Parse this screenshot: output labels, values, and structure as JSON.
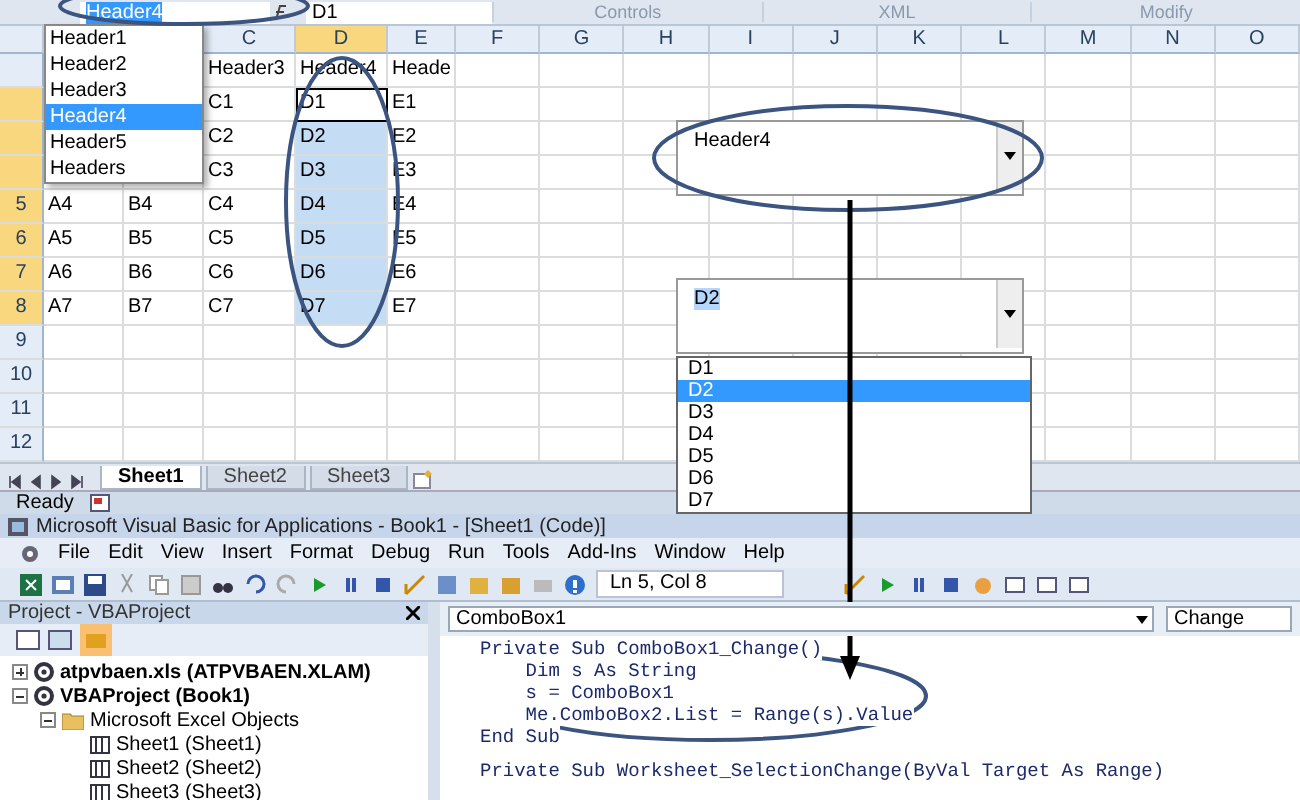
{
  "excel": {
    "name_box": "Header4",
    "formula": "D1",
    "ribbon_groups": [
      "Controls",
      "XML",
      "Modify"
    ],
    "name_box_list": [
      {
        "label": "Header1",
        "selected": false
      },
      {
        "label": "Header2",
        "selected": false
      },
      {
        "label": "Header3",
        "selected": false
      },
      {
        "label": "Header4",
        "selected": true
      },
      {
        "label": "Header5",
        "selected": false
      },
      {
        "label": "Headers",
        "selected": false
      }
    ],
    "columns": [
      {
        "label": "C",
        "selected": false
      },
      {
        "label": "D",
        "selected": true
      },
      {
        "label": "E",
        "selected": false
      },
      {
        "label": "F",
        "selected": false
      },
      {
        "label": "G",
        "selected": false
      },
      {
        "label": "H",
        "selected": false
      },
      {
        "label": "I",
        "selected": false
      },
      {
        "label": "J",
        "selected": false
      },
      {
        "label": "K",
        "selected": false
      },
      {
        "label": "L",
        "selected": false
      },
      {
        "label": "M",
        "selected": false
      },
      {
        "label": "N",
        "selected": false
      },
      {
        "label": "O",
        "selected": false
      }
    ],
    "rows": [
      {
        "cells": [
          "Header3",
          "Header4",
          "Heade"
        ],
        "selected": false
      },
      {
        "cells": [
          "C1",
          "D1",
          "E1"
        ],
        "selected": true,
        "active": true
      },
      {
        "cells": [
          "C2",
          "D2",
          "E2"
        ],
        "selected": true
      },
      {
        "cells": [
          "C3",
          "D3",
          "E3"
        ],
        "selected": true
      },
      {
        "number": "5",
        "a": "A4",
        "b": "B4",
        "cells": [
          "C4",
          "D4",
          "E4"
        ],
        "selected": true
      },
      {
        "number": "6",
        "a": "A5",
        "b": "B5",
        "cells": [
          "C5",
          "D5",
          "E5"
        ],
        "selected": true
      },
      {
        "number": "7",
        "a": "A6",
        "b": "B6",
        "cells": [
          "C6",
          "D6",
          "E6"
        ],
        "selected": true
      },
      {
        "number": "8",
        "a": "A7",
        "b": "B7",
        "cells": [
          "C7",
          "D7",
          "E7"
        ],
        "selected": true
      },
      {
        "number": "9",
        "selected": false
      },
      {
        "number": "10",
        "selected": false
      },
      {
        "number": "11",
        "selected": false
      },
      {
        "number": "12",
        "selected": false
      }
    ],
    "combobox1": {
      "value": "Header4"
    },
    "combobox2": {
      "value": "D2",
      "list": [
        {
          "label": "D1",
          "selected": false
        },
        {
          "label": "D2",
          "selected": true
        },
        {
          "label": "D3",
          "selected": false
        },
        {
          "label": "D4",
          "selected": false
        },
        {
          "label": "D5",
          "selected": false
        },
        {
          "label": "D6",
          "selected": false
        },
        {
          "label": "D7",
          "selected": false
        }
      ]
    },
    "sheet_tabs": [
      {
        "label": "Sheet1",
        "selected": true
      },
      {
        "label": "Sheet2",
        "selected": false
      },
      {
        "label": "Sheet3",
        "selected": false
      }
    ],
    "status": "Ready"
  },
  "vba": {
    "title": "Microsoft Visual Basic for Applications - Book1 - [Sheet1 (Code)]",
    "menu": [
      "File",
      "Edit",
      "View",
      "Insert",
      "Format",
      "Debug",
      "Run",
      "Tools",
      "Add-Ins",
      "Window",
      "Help"
    ],
    "position": "Ln 5, Col 8",
    "project": {
      "title": "Project - VBAProject",
      "tree": [
        {
          "label": "atpvbaen.xls (ATPVBAEN.XLAM)",
          "kind": "project",
          "expanded": false
        },
        {
          "label": "VBAProject (Book1)",
          "kind": "project",
          "expanded": true,
          "children": [
            {
              "label": "Microsoft Excel Objects",
              "kind": "folder",
              "expanded": true,
              "children": [
                {
                  "label": "Sheet1 (Sheet1)",
                  "kind": "sheet"
                },
                {
                  "label": "Sheet2 (Sheet2)",
                  "kind": "sheet"
                },
                {
                  "label": "Sheet3 (Sheet3)",
                  "kind": "sheet"
                }
              ]
            }
          ]
        }
      ]
    },
    "object": "ComboBox1",
    "procedure": "Change",
    "code": [
      [
        "Private Sub ComboBox1_Change()",
        "    Dim s As String",
        "    s = ComboBox1",
        "    Me.ComboBox2.List = Range(s).Value",
        "End Sub"
      ],
      [
        "Private Sub Worksheet_SelectionChange(ByVal Target As Range)"
      ]
    ]
  }
}
